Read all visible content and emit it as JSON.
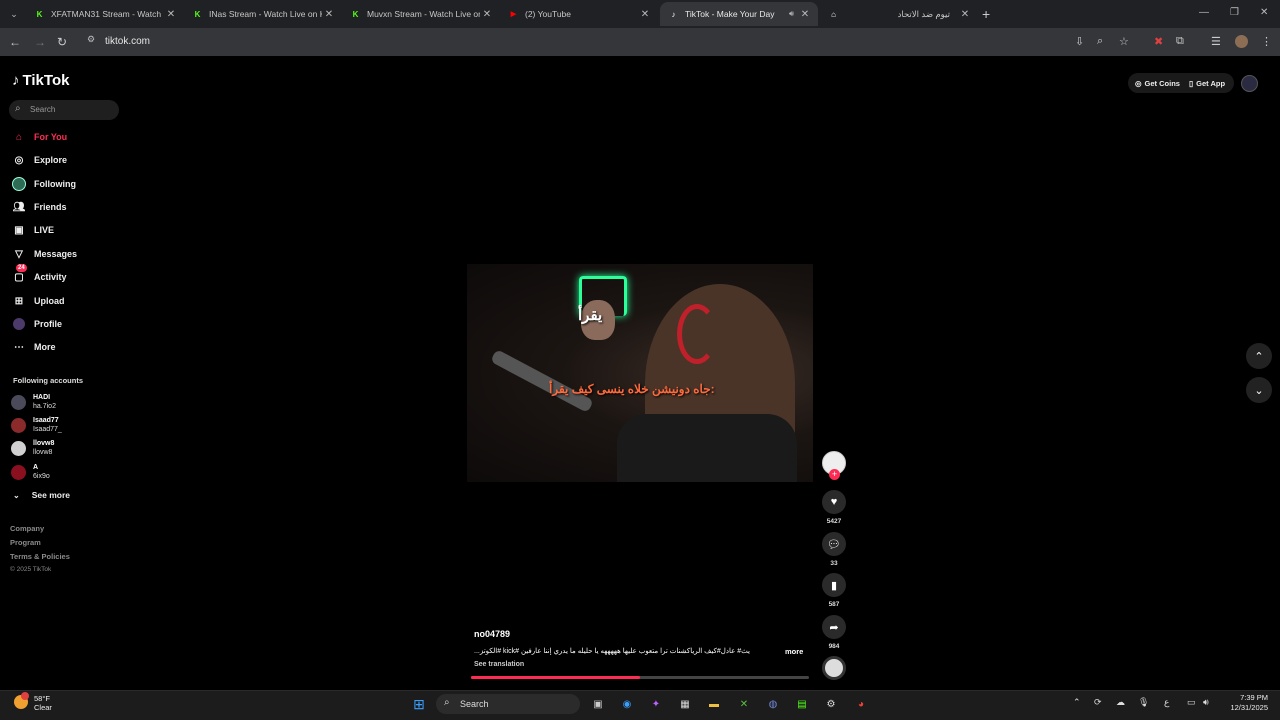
{
  "browser": {
    "tabs": [
      {
        "title": "XFATMAN31 Stream - Watch Li",
        "favicon": "kick-icon"
      },
      {
        "title": "INas Stream - Watch Live on Ki",
        "favicon": "kick-icon"
      },
      {
        "title": "Muvxn Stream - Watch Live on",
        "favicon": "kick-icon"
      },
      {
        "title": "(2) YouTube",
        "favicon": "youtube-icon"
      },
      {
        "title": "TikTok - Make Your Day",
        "favicon": "tiktok-icon",
        "active": true
      },
      {
        "title": "تيوم ضد الاتحاد",
        "favicon": "house-icon"
      }
    ],
    "url": "tiktok.com"
  },
  "tiktok": {
    "logo": "TikTok",
    "search_placeholder": "Search",
    "nav": [
      {
        "label": "For You",
        "icon": "home-icon",
        "active": true
      },
      {
        "label": "Explore",
        "icon": "compass-icon"
      },
      {
        "label": "Following",
        "icon": "following-icon"
      },
      {
        "label": "Friends",
        "icon": "friends-icon"
      },
      {
        "label": "LIVE",
        "icon": "live-icon"
      },
      {
        "label": "Messages",
        "icon": "send-icon"
      },
      {
        "label": "Activity",
        "icon": "inbox-icon",
        "badge": "24"
      },
      {
        "label": "Upload",
        "icon": "plus-square-icon"
      },
      {
        "label": "Profile",
        "icon": "profile-avatar"
      },
      {
        "label": "More",
        "icon": "ellipsis-icon"
      }
    ],
    "following_title": "Following accounts",
    "following_accounts": [
      {
        "name": "HADI",
        "handle": "ha.7io2",
        "color": "#4a4a5a"
      },
      {
        "name": "Isaad77",
        "handle": "Isaad77_",
        "color": "#8a2a2a"
      },
      {
        "name": "llovw8",
        "handle": "llovw8",
        "color": "#d0d0d0"
      },
      {
        "name": "A",
        "handle": "6ix9o",
        "color": "#8a1020"
      }
    ],
    "see_more": "See more",
    "footer": [
      "Company",
      "Program",
      "Terms & Policies"
    ],
    "copyright": "© 2025 TikTok",
    "get_coins": "Get Coins",
    "get_app": "Get App"
  },
  "video": {
    "overlay_top": "يقرأ",
    "overlay_subtitle": "جاه دونيشن خلاه ينسى كيف يقرأ:",
    "author": "no04789",
    "caption": "يث# عادل#كيف الرياكشنات ترا متعوب عليها هههههه يا حليله ما يدري إننا عارفين #kick #الكوتز...",
    "more": "more",
    "see_translation": "See translation",
    "likes": "5427",
    "comments": "33",
    "saves": "587",
    "shares": "984",
    "progress": 0.5
  },
  "taskbar": {
    "temperature": "58°F",
    "condition": "Clear",
    "search": "Search",
    "time": "7:39 PM",
    "date": "12/31/2025",
    "lang": "ع"
  }
}
